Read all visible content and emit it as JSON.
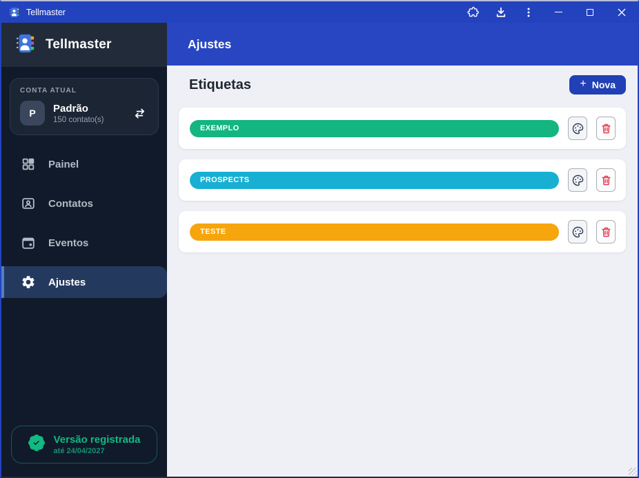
{
  "colors": {
    "brand_blue": "#2342bd",
    "active_accent": "#4f80c3",
    "success_green": "#12b981",
    "danger_red": "#e5394e"
  },
  "titlebar": {
    "title": "Tellmaster"
  },
  "sidebar": {
    "brand": "Tellmaster",
    "account": {
      "label": "CONTA ATUAL",
      "initial": "P",
      "name": "Padrão",
      "detail": "150 contato(s)"
    },
    "menu": [
      {
        "label": "Painel",
        "icon": "dashboard-icon",
        "active": false
      },
      {
        "label": "Contatos",
        "icon": "contacts-icon",
        "active": false
      },
      {
        "label": "Eventos",
        "icon": "calendar-icon",
        "active": false
      },
      {
        "label": "Ajustes",
        "icon": "gear-icon",
        "active": true
      }
    ],
    "version": {
      "icon": "badge-check-icon",
      "title": "Versão registrada",
      "subtitle": "até 24/04/2027"
    }
  },
  "header": {
    "title": "Ajustes"
  },
  "main": {
    "section_title": "Etiquetas",
    "new_button": {
      "plus": "+",
      "label": "Nova"
    },
    "labels": [
      {
        "name": "EXEMPLO",
        "color": "#13b581"
      },
      {
        "name": "PROSPECTS",
        "color": "#17b0d3"
      },
      {
        "name": "TESTE",
        "color": "#f7a50c"
      }
    ]
  }
}
